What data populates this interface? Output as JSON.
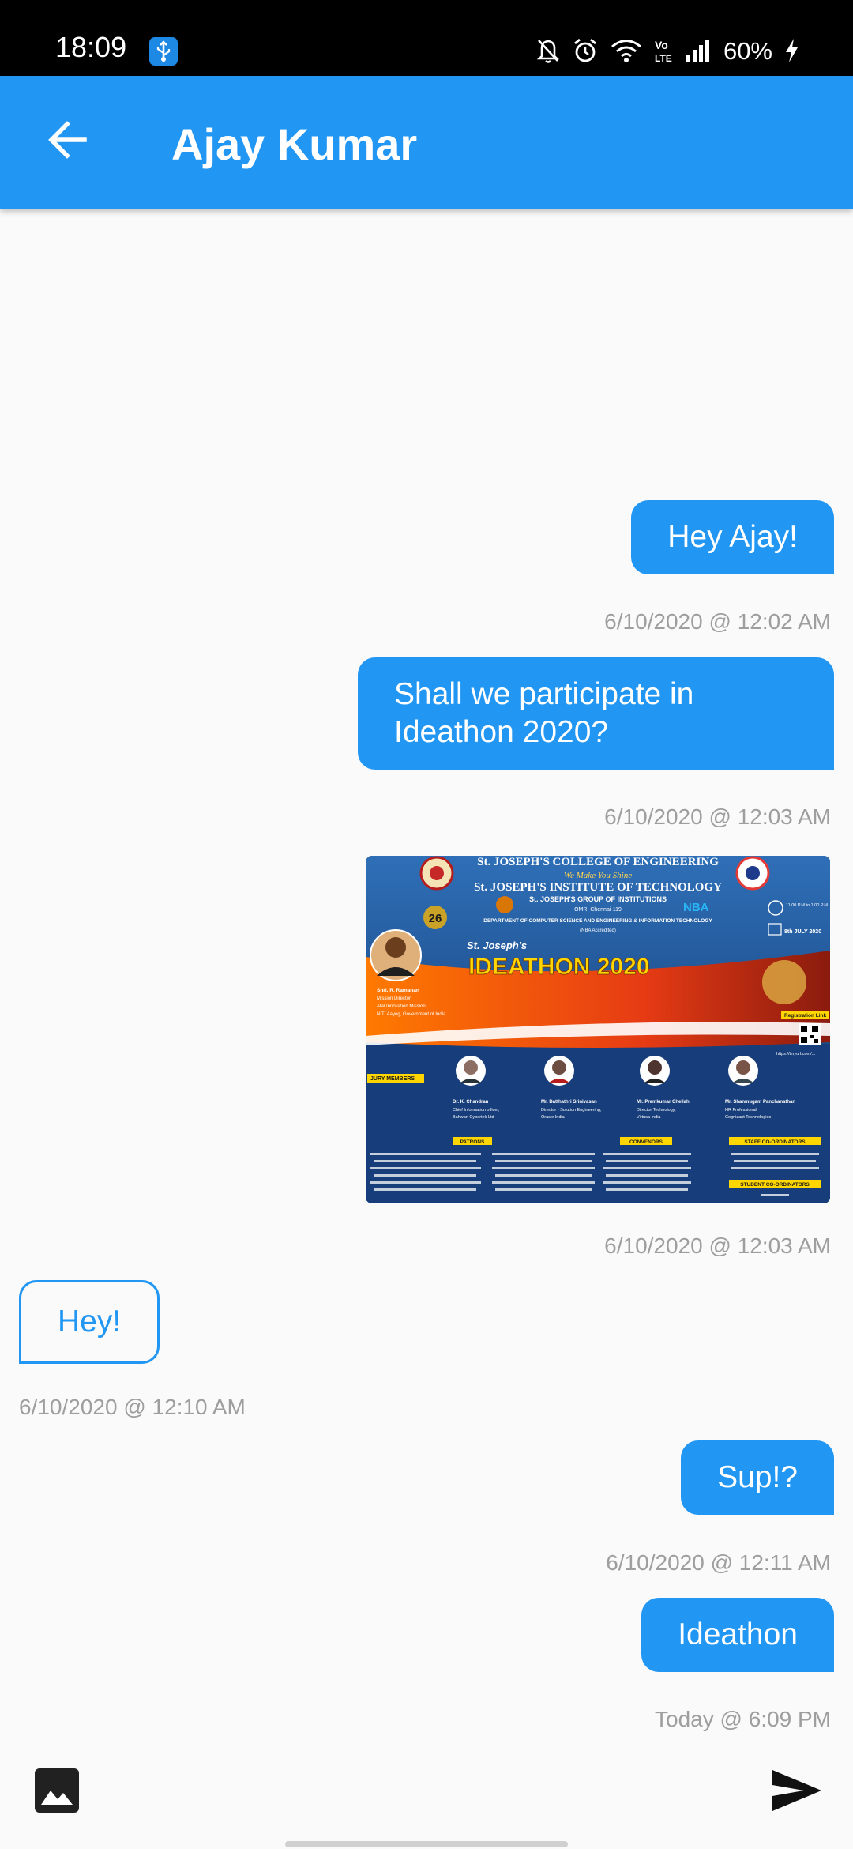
{
  "status_bar": {
    "time": "18:09",
    "battery": "60%"
  },
  "header": {
    "title": "Ajay Kumar",
    "back_icon": "arrow-left-icon"
  },
  "messages": [
    {
      "direction": "sent",
      "text": "Hey Ajay!",
      "time": "6/10/2020 @ 12:02 AM"
    },
    {
      "direction": "sent",
      "text": "Shall we participate in Ideathon 2020?",
      "time": "6/10/2020 @ 12:03 AM"
    },
    {
      "direction": "sent",
      "type": "image",
      "time": "6/10/2020 @ 12:03 AM"
    },
    {
      "direction": "received",
      "text": "Hey!",
      "time": "6/10/2020 @ 12:10 AM"
    },
    {
      "direction": "sent",
      "text": "Sup!?",
      "time": "6/10/2020 @ 12:11 AM"
    },
    {
      "direction": "sent",
      "text": "Ideathon",
      "time": "Today @ 6:09 PM"
    }
  ],
  "poster": {
    "college_line": "St. JOSEPH'S COLLEGE OF ENGINEERING",
    "motto": "We Make You Shine",
    "institute_line": "St. JOSEPH'S INSTITUTE OF TECHNOLOGY",
    "group_line": "St. JOSEPH'S GROUP OF INSTITUTIONS",
    "location": "OMR, Chennai-119",
    "department": "DEPARTMENT OF COMPUTER SCIENCE AND ENGINEERING & INFORMATION TECHNOLOGY",
    "accreditation": "(NBA Accredited)",
    "anniversary": "26",
    "badge": "NBA",
    "event_time": "11:00 P.M to 1:00 P.M",
    "event_date": "8th JULY 2020",
    "event_prefix": "St. Joseph's",
    "event_name": "IDEATHON 2020",
    "speaker_name": "Shri. R. Ramanan",
    "speaker_role1": "Mission Director,",
    "speaker_role2": "Atal Innovation Mission,",
    "speaker_role3": "NITI Aayog, Government of India",
    "register_label": "Registration Link",
    "register_url": "https://tinyurl.com/...",
    "jury_label": "JURY MEMBERS",
    "jury": [
      {
        "name": "Dr. K. Chandran",
        "role1": "Chief Information officer,",
        "role2": "Bahwan Cybertek Ltd"
      },
      {
        "name": "Mr. Datthathri Srinivasan",
        "role1": "Director - Solution Engineering,",
        "role2": "Oracle India"
      },
      {
        "name": "Mr. Premkumar Chellah",
        "role1": "Director Technology,",
        "role2": "Virtusa India"
      },
      {
        "name": "Mr. Shanmugam Panchanathan",
        "role1": "HR Professional,",
        "role2": "Cognizant Technologies"
      }
    ],
    "patrons_label": "PATRONS",
    "convenors_label": "CONVENORS",
    "staff_label": "STAFF CO-ORDINATORS",
    "student_label": "STUDENT CO-ORDINATORS"
  },
  "composer": {
    "gallery_icon": "image-icon",
    "send_icon": "send-icon"
  },
  "colors": {
    "primary": "#2196f3",
    "status_bar": "#000000",
    "background": "#fafafa",
    "timestamp": "#9e9e9e"
  }
}
